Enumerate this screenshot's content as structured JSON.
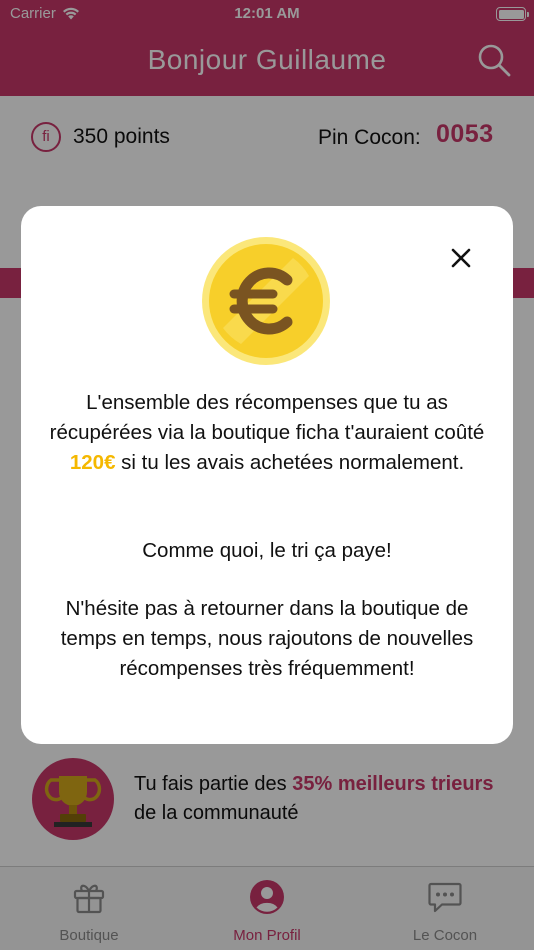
{
  "status_bar": {
    "carrier": "Carrier",
    "time": "12:01 AM"
  },
  "header": {
    "title": "Bonjour Guillaume",
    "search_icon": "search-icon"
  },
  "points": {
    "icon_text": "fi",
    "text": "350 points",
    "pin_label": "Pin Cocon:",
    "pin_value": "0053"
  },
  "stats": {
    "text_before": "Tu fais partie des ",
    "highlight": "35% meilleurs trieurs",
    "text_after": " de la communauté"
  },
  "modal": {
    "p1_before": "L'ensemble des récompenses que tu as récupérées via la boutique ficha t'auraient coûté ",
    "amount": "120€",
    "p1_after": " si tu les avais achetées normalement.",
    "p2": "Comme quoi, le tri ça paye!",
    "p3": "N'hésite pas à retourner dans la boutique de temps en temps, nous rajoutons de nouvelles récompenses très fréquemment!"
  },
  "tabs": [
    {
      "label": "Boutique",
      "icon": "gift-icon",
      "active": false
    },
    {
      "label": "Mon Profil",
      "icon": "profile-icon",
      "active": true
    },
    {
      "label": "Le Cocon",
      "icon": "chat-icon",
      "active": false
    }
  ],
  "colors": {
    "brand": "#c8376a",
    "amount": "#f5b800",
    "coin": "#f7cf2a",
    "tab_inactive": "#8a8a8a"
  }
}
